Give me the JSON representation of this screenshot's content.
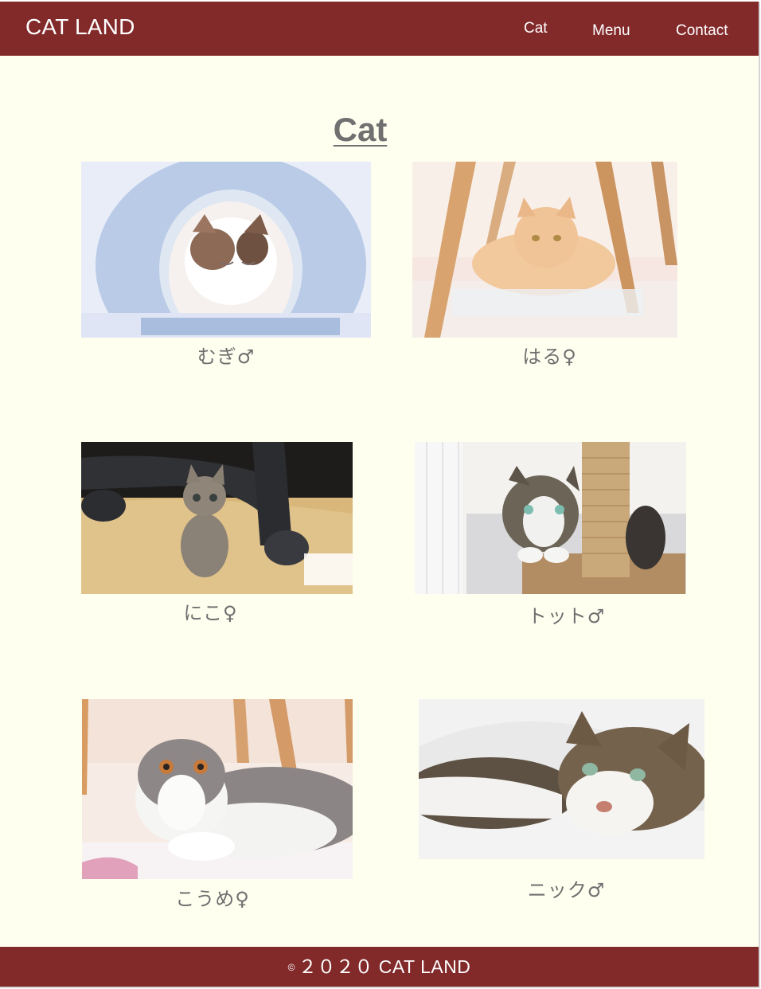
{
  "header": {
    "site_title": "CAT LAND",
    "nav": {
      "cat": "Cat",
      "menu": "Menu",
      "contact": "Contact"
    }
  },
  "main": {
    "title": "Cat",
    "cards": [
      {
        "caption": "むぎ♂"
      },
      {
        "caption": "はる♀"
      },
      {
        "caption": "にこ♀"
      },
      {
        "caption": "トット♂"
      },
      {
        "caption": "こうめ♀"
      },
      {
        "caption": "ニック♂"
      }
    ]
  },
  "footer": {
    "copyright_symbol": "©",
    "text": "２０２０ CAT LAND"
  },
  "colors": {
    "header_bg": "#82292a",
    "page_bg": "#fffff0",
    "text_gray": "#6f6f6f"
  }
}
